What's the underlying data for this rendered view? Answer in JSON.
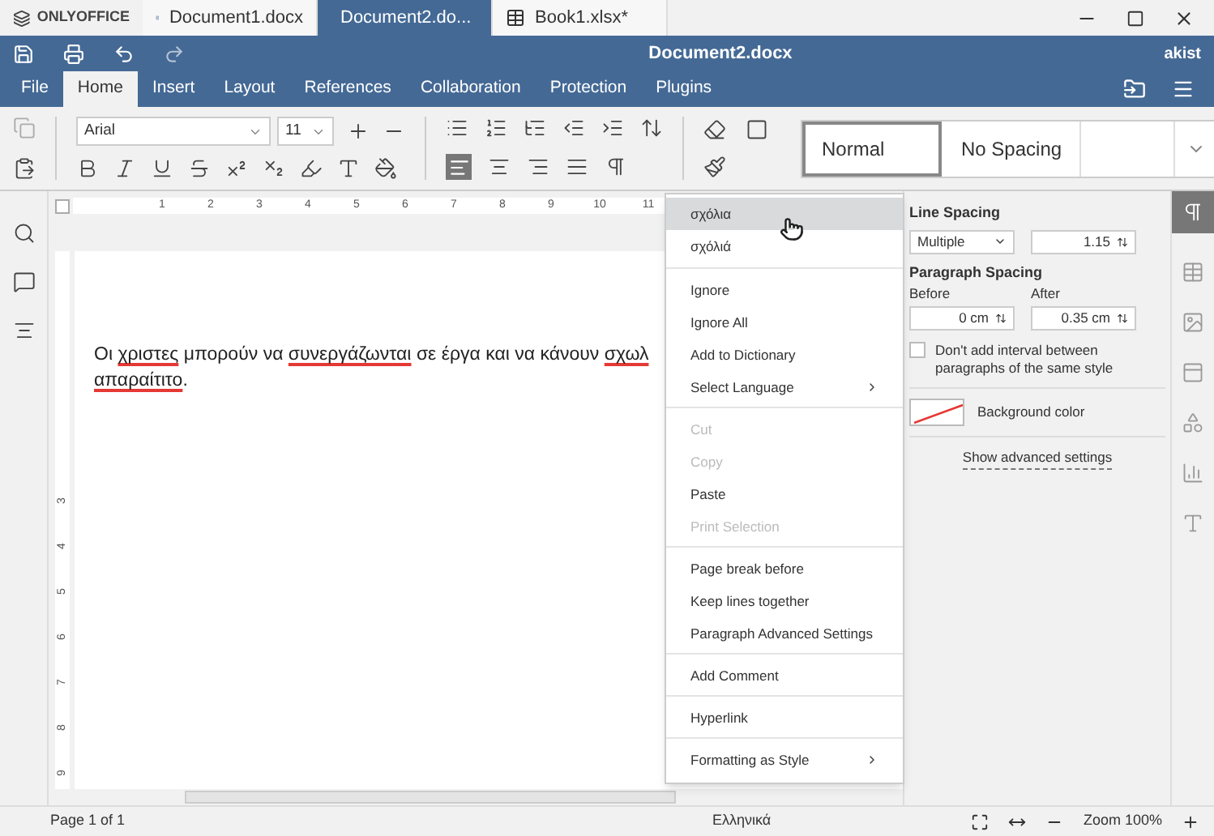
{
  "app_tabs": {
    "logo": "ONLYOFFICE",
    "tabs": [
      {
        "label": "Document1.docx",
        "kind": "doc",
        "selected": false,
        "closable": false
      },
      {
        "label": "Document2.do...",
        "kind": "doc",
        "selected": true,
        "closable": true
      },
      {
        "label": "Book1.xlsx*",
        "kind": "sheet",
        "selected": false,
        "closable": false
      }
    ]
  },
  "title_bar": {
    "title": "Document2.docx",
    "user": "akist"
  },
  "menu_tabs": [
    {
      "label": "File",
      "selected": false
    },
    {
      "label": "Home",
      "selected": true
    },
    {
      "label": "Insert",
      "selected": false
    },
    {
      "label": "Layout",
      "selected": false
    },
    {
      "label": "References",
      "selected": false
    },
    {
      "label": "Collaboration",
      "selected": false
    },
    {
      "label": "Protection",
      "selected": false
    },
    {
      "label": "Plugins",
      "selected": false
    }
  ],
  "toolbar": {
    "font": "Arial",
    "size": "11",
    "align_left": true
  },
  "styles": [
    {
      "label": "Normal",
      "selected": true
    },
    {
      "label": "No Spacing",
      "selected": false
    }
  ],
  "ruler": {
    "labels": [
      "1",
      "2",
      "3",
      "4",
      "5",
      "6",
      "7",
      "8",
      "9",
      "10",
      "11"
    ],
    "vertical_labels": [
      "3",
      "4",
      "5",
      "6",
      "7",
      "8",
      "9"
    ]
  },
  "document": {
    "lines": [
      [
        {
          "text": "Οι ",
          "misspelled": false
        },
        {
          "text": "χριστες",
          "misspelled": true
        },
        {
          "text": " μπορούν να ",
          "misspelled": false
        },
        {
          "text": "συνεργάζωνται",
          "misspelled": true
        },
        {
          "text": " σε έργα και να κάνουν ",
          "misspelled": false
        },
        {
          "text": "σχωλ",
          "misspelled": true
        }
      ],
      [
        {
          "text": "απαραίτιτο",
          "misspelled": true
        },
        {
          "text": ".",
          "misspelled": false
        }
      ]
    ]
  },
  "context_menu": {
    "groups": [
      [
        {
          "label": "σχόλια",
          "highlighted": true,
          "disabled": false,
          "submenu": false
        },
        {
          "label": "σχόλιά",
          "highlighted": false,
          "disabled": false,
          "submenu": false
        }
      ],
      [
        {
          "label": "Ignore",
          "highlighted": false,
          "disabled": false,
          "submenu": false
        },
        {
          "label": "Ignore All",
          "highlighted": false,
          "disabled": false,
          "submenu": false
        },
        {
          "label": "Add to Dictionary",
          "highlighted": false,
          "disabled": false,
          "submenu": false
        },
        {
          "label": "Select Language",
          "highlighted": false,
          "disabled": false,
          "submenu": true
        }
      ],
      [
        {
          "label": "Cut",
          "highlighted": false,
          "disabled": true,
          "submenu": false
        },
        {
          "label": "Copy",
          "highlighted": false,
          "disabled": true,
          "submenu": false
        },
        {
          "label": "Paste",
          "highlighted": false,
          "disabled": false,
          "submenu": false
        },
        {
          "label": "Print Selection",
          "highlighted": false,
          "disabled": true,
          "submenu": false
        }
      ],
      [
        {
          "label": "Page break before",
          "highlighted": false,
          "disabled": false,
          "submenu": false
        },
        {
          "label": "Keep lines together",
          "highlighted": false,
          "disabled": false,
          "submenu": false
        },
        {
          "label": "Paragraph Advanced Settings",
          "highlighted": false,
          "disabled": false,
          "submenu": false
        }
      ],
      [
        {
          "label": "Add Comment",
          "highlighted": false,
          "disabled": false,
          "submenu": false
        }
      ],
      [
        {
          "label": "Hyperlink",
          "highlighted": false,
          "disabled": false,
          "submenu": false
        }
      ],
      [
        {
          "label": "Formatting as Style",
          "highlighted": false,
          "disabled": false,
          "submenu": true
        }
      ]
    ]
  },
  "paragraph_panel": {
    "line_spacing_label": "Line Spacing",
    "line_spacing_type": "Multiple",
    "line_spacing_value": "1.15",
    "paragraph_spacing_label": "Paragraph Spacing",
    "before_label": "Before",
    "before_value": "0 cm",
    "after_label": "After",
    "after_value": "0.35 cm",
    "no_interval": {
      "label": "Don't add interval between paragraphs of the same style",
      "checked": false
    },
    "background_label": "Background color",
    "advanced_link": "Show advanced settings"
  },
  "right_tabs": [
    {
      "kind": "paragraph",
      "selected": true
    },
    {
      "kind": "table",
      "selected": false
    },
    {
      "kind": "image",
      "selected": false
    },
    {
      "kind": "header",
      "selected": false
    },
    {
      "kind": "shape",
      "selected": false
    },
    {
      "kind": "chart",
      "selected": false
    },
    {
      "kind": "textart",
      "selected": false
    }
  ],
  "status_bar": {
    "page": "Page 1 of 1",
    "language": "Ελληνικά",
    "zoom": "Zoom 100%"
  }
}
